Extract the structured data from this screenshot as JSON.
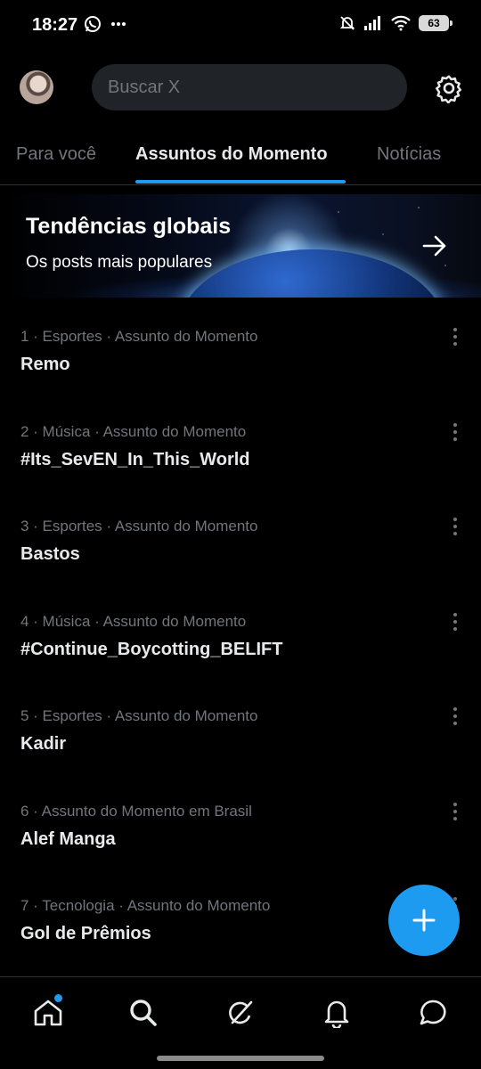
{
  "status_bar": {
    "time": "18:27",
    "battery": "63",
    "icons": [
      "whatsapp-icon",
      "more-dots-icon",
      "mute-icon",
      "signal-icon",
      "wifi-icon",
      "battery-icon"
    ]
  },
  "header": {
    "search_placeholder": "Buscar X",
    "icons": [
      "avatar",
      "gear-icon"
    ]
  },
  "tabs": [
    {
      "label": "Para você",
      "active": false
    },
    {
      "label": "Assuntos do Momento",
      "active": true
    },
    {
      "label": "Notícias",
      "active": false
    }
  ],
  "banner": {
    "title": "Tendências globais",
    "subtitle": "Os posts mais populares",
    "icon": "arrow-right-icon"
  },
  "trends": [
    {
      "meta": "1 · Esportes · Assunto do Momento",
      "name": "Remo"
    },
    {
      "meta": "2 · Música · Assunto do Momento",
      "name": "#Its_SevEN_In_This_World"
    },
    {
      "meta": "3 · Esportes · Assunto do Momento",
      "name": "Bastos"
    },
    {
      "meta": "4 · Música · Assunto do Momento",
      "name": "#Continue_Boycotting_BELIFT"
    },
    {
      "meta": "5 · Esportes · Assunto do Momento",
      "name": "Kadir"
    },
    {
      "meta": "6 · Assunto do Momento em Brasil",
      "name": "Alef Manga"
    },
    {
      "meta": "7 · Tecnologia · Assunto do Momento",
      "name": "Gol de Prêmios"
    }
  ],
  "bottom_nav": [
    "home-icon",
    "search-icon",
    "grok-icon",
    "bell-icon",
    "messages-icon"
  ],
  "colors": {
    "accent": "#1d9bf0",
    "background": "#000000",
    "muted": "#71767b",
    "text": "#e7e9ea"
  }
}
